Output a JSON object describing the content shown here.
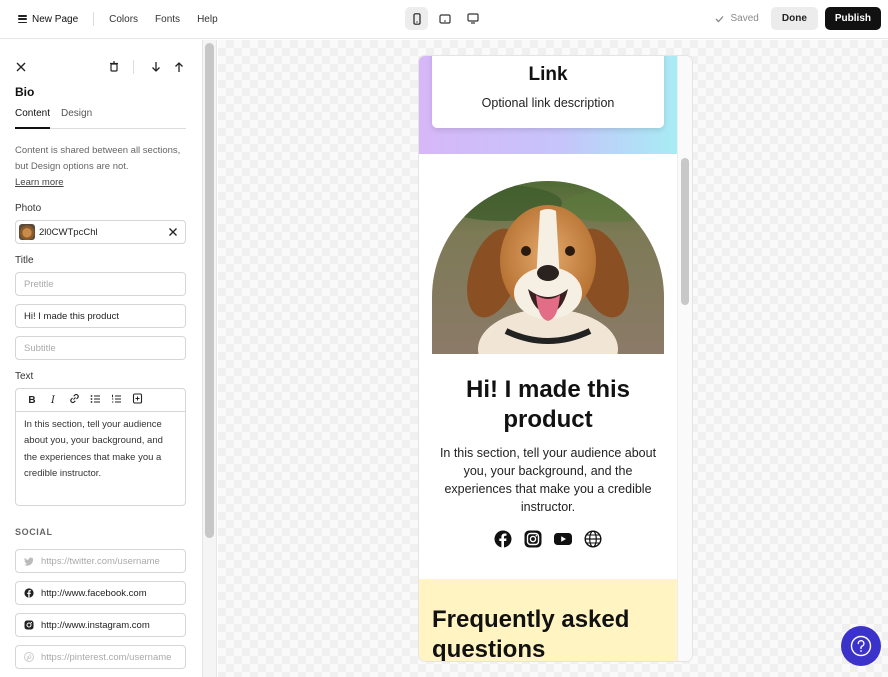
{
  "topbar": {
    "page_title": "New Page",
    "menu": [
      "Colors",
      "Fonts",
      "Help"
    ],
    "saved_label": "Saved",
    "done_label": "Done",
    "publish_label": "Publish"
  },
  "panel": {
    "heading": "Bio",
    "tabs": [
      "Content",
      "Design"
    ],
    "note": "Content is shared between all sections, but Design options are not.",
    "learn_more": "Learn more",
    "photo_label": "Photo",
    "photo_value": "2l0CWTpcChl",
    "title_label": "Title",
    "pretitle_placeholder": "Pretitle",
    "title_value": "Hi! I made this product",
    "subtitle_placeholder": "Subtitle",
    "text_label": "Text",
    "text_value": "In this section, tell your audience about you, your background, and the experiences that make you a credible instructor.",
    "social_caption": "SOCIAL",
    "social": {
      "twitter_placeholder": "https://twitter.com/username",
      "facebook_value": "http://www.facebook.com",
      "instagram_value": "http://www.instagram.com",
      "pinterest_placeholder": "https://pinterest.com/username"
    }
  },
  "preview": {
    "link_title": "Link",
    "link_description": "Optional link description",
    "bio_title": "Hi! I made this product",
    "bio_text": "In this section, tell your audience about you, your background, and the experiences that make you a credible instructor.",
    "faq_title": "Frequently asked questions"
  },
  "colors": {
    "publish_bg": "#111111",
    "help_bg": "#3b32c9",
    "faq_bg": "#fff4c2"
  }
}
